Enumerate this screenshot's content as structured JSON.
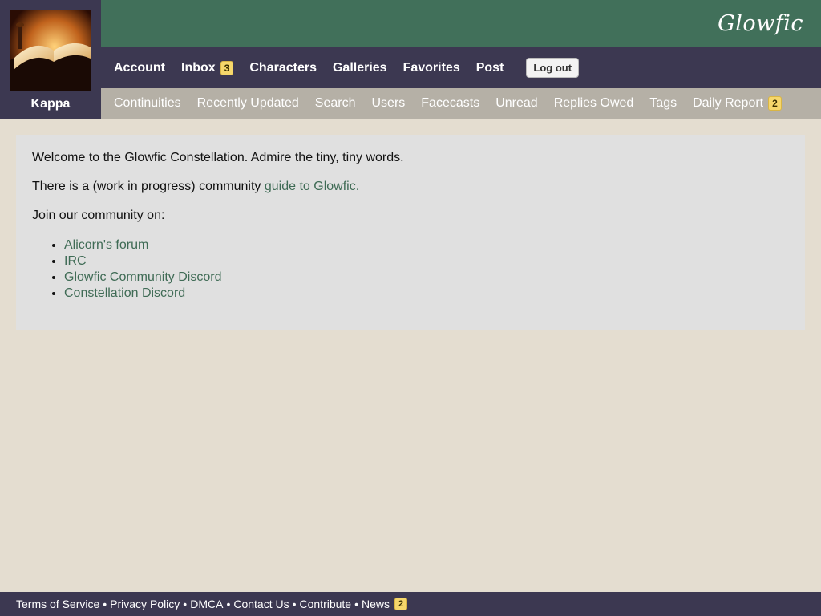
{
  "user": {
    "name": "Kappa",
    "avatar_icon": "open-book-avatar"
  },
  "header": {
    "logo": "Glowfic"
  },
  "nav_primary": {
    "items": [
      {
        "label": "Account"
      },
      {
        "label": "Inbox",
        "badge": "3"
      },
      {
        "label": "Characters"
      },
      {
        "label": "Galleries"
      },
      {
        "label": "Favorites"
      },
      {
        "label": "Post"
      }
    ],
    "logout_label": "Log out"
  },
  "nav_secondary": {
    "items": [
      {
        "label": "Continuities"
      },
      {
        "label": "Recently Updated"
      },
      {
        "label": "Search"
      },
      {
        "label": "Users"
      },
      {
        "label": "Facecasts"
      },
      {
        "label": "Unread"
      },
      {
        "label": "Replies Owed"
      },
      {
        "label": "Tags"
      },
      {
        "label": "Daily Report",
        "badge": "2"
      }
    ]
  },
  "main": {
    "welcome": "Welcome to the Glowfic Constellation. Admire the tiny, tiny words.",
    "guide_prefix": "There is a (work in progress) community ",
    "guide_link": "guide to Glowfic.",
    "join_text": "Join our community on:",
    "links": [
      "Alicorn's forum",
      "IRC",
      "Glowfic Community Discord",
      "Constellation Discord"
    ]
  },
  "footer": {
    "tos": "Terms of Service",
    "privacy": "Privacy Policy",
    "dmca": "DMCA",
    "contact": "Contact Us",
    "contribute": "Contribute",
    "news": "News",
    "news_badge": "2",
    "separator": "•"
  },
  "colors": {
    "header_green": "#41705a",
    "nav_dark": "#3c3851",
    "nav_secondary": "#b5b0a6",
    "page_bg": "#e4ddd0",
    "content_bg": "#e0e0e0",
    "link": "#3f6b55",
    "badge": "#f6d76b"
  }
}
